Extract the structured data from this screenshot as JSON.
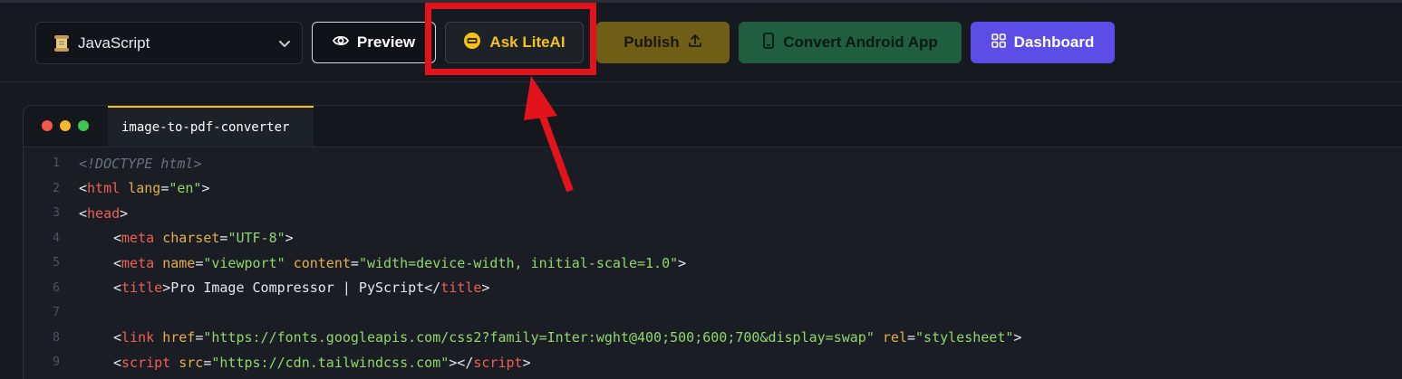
{
  "toolbar": {
    "language_select": {
      "value": "JavaScript",
      "icon": "scroll-icon"
    },
    "preview_label": "Preview",
    "ask_label": "Ask LiteAI",
    "publish_label": "Publish",
    "convert_label": "Convert Android App",
    "dashboard_label": "Dashboard"
  },
  "colors": {
    "background": "#161a20",
    "ask_accent": "#f6c21a",
    "publish_bg": "#6f5f16",
    "convert_bg": "#1f5e3f",
    "dashboard_bg": "#5b4de6",
    "highlight": "#e3131b"
  },
  "editor": {
    "tab_label": "image-to-pdf-converter",
    "lines": [
      {
        "n": "1",
        "indent": false,
        "tokens": [
          {
            "t": "cmt",
            "v": "<!DOCTYPE html>"
          }
        ]
      },
      {
        "n": "2",
        "indent": false,
        "tokens": [
          {
            "t": "punct",
            "v": "<"
          },
          {
            "t": "tag",
            "v": "html"
          },
          {
            "t": "punct",
            "v": " "
          },
          {
            "t": "attr",
            "v": "lang"
          },
          {
            "t": "punct",
            "v": "="
          },
          {
            "t": "str",
            "v": "\"en\""
          },
          {
            "t": "punct",
            "v": ">"
          }
        ]
      },
      {
        "n": "3",
        "indent": false,
        "tokens": [
          {
            "t": "punct",
            "v": "<"
          },
          {
            "t": "tag",
            "v": "head"
          },
          {
            "t": "punct",
            "v": ">"
          }
        ]
      },
      {
        "n": "4",
        "indent": true,
        "tokens": [
          {
            "t": "punct",
            "v": "<"
          },
          {
            "t": "tag",
            "v": "meta"
          },
          {
            "t": "punct",
            "v": " "
          },
          {
            "t": "attr",
            "v": "charset"
          },
          {
            "t": "punct",
            "v": "="
          },
          {
            "t": "str",
            "v": "\"UTF-8\""
          },
          {
            "t": "punct",
            "v": ">"
          }
        ]
      },
      {
        "n": "5",
        "indent": true,
        "tokens": [
          {
            "t": "punct",
            "v": "<"
          },
          {
            "t": "tag",
            "v": "meta"
          },
          {
            "t": "punct",
            "v": " "
          },
          {
            "t": "attr",
            "v": "name"
          },
          {
            "t": "punct",
            "v": "="
          },
          {
            "t": "str",
            "v": "\"viewport\""
          },
          {
            "t": "punct",
            "v": " "
          },
          {
            "t": "attr",
            "v": "content"
          },
          {
            "t": "punct",
            "v": "="
          },
          {
            "t": "str",
            "v": "\"width=device-width, initial-scale=1.0\""
          },
          {
            "t": "punct",
            "v": ">"
          }
        ]
      },
      {
        "n": "6",
        "indent": true,
        "tokens": [
          {
            "t": "punct",
            "v": "<"
          },
          {
            "t": "tag",
            "v": "title"
          },
          {
            "t": "punct",
            "v": ">"
          },
          {
            "t": "txt",
            "v": "Pro Image Compressor | PyScript"
          },
          {
            "t": "punct",
            "v": "</"
          },
          {
            "t": "tag",
            "v": "title"
          },
          {
            "t": "punct",
            "v": ">"
          }
        ]
      },
      {
        "n": "7",
        "indent": false,
        "tokens": []
      },
      {
        "n": "8",
        "indent": true,
        "tokens": [
          {
            "t": "punct",
            "v": "<"
          },
          {
            "t": "tag",
            "v": "link"
          },
          {
            "t": "punct",
            "v": " "
          },
          {
            "t": "attr",
            "v": "href"
          },
          {
            "t": "punct",
            "v": "="
          },
          {
            "t": "str",
            "v": "\"https://fonts.googleapis.com/css2?family=Inter:wght@400;500;600;700&display=swap\""
          },
          {
            "t": "punct",
            "v": " "
          },
          {
            "t": "attr",
            "v": "rel"
          },
          {
            "t": "punct",
            "v": "="
          },
          {
            "t": "str",
            "v": "\"stylesheet\""
          },
          {
            "t": "punct",
            "v": ">"
          }
        ]
      },
      {
        "n": "9",
        "indent": true,
        "tokens": [
          {
            "t": "punct",
            "v": "<"
          },
          {
            "t": "tag",
            "v": "script"
          },
          {
            "t": "punct",
            "v": " "
          },
          {
            "t": "attr",
            "v": "src"
          },
          {
            "t": "punct",
            "v": "="
          },
          {
            "t": "str",
            "v": "\"https://cdn.tailwindcss.com\""
          },
          {
            "t": "punct",
            "v": "></"
          },
          {
            "t": "tag",
            "v": "script"
          },
          {
            "t": "punct",
            "v": ">"
          }
        ]
      }
    ]
  }
}
